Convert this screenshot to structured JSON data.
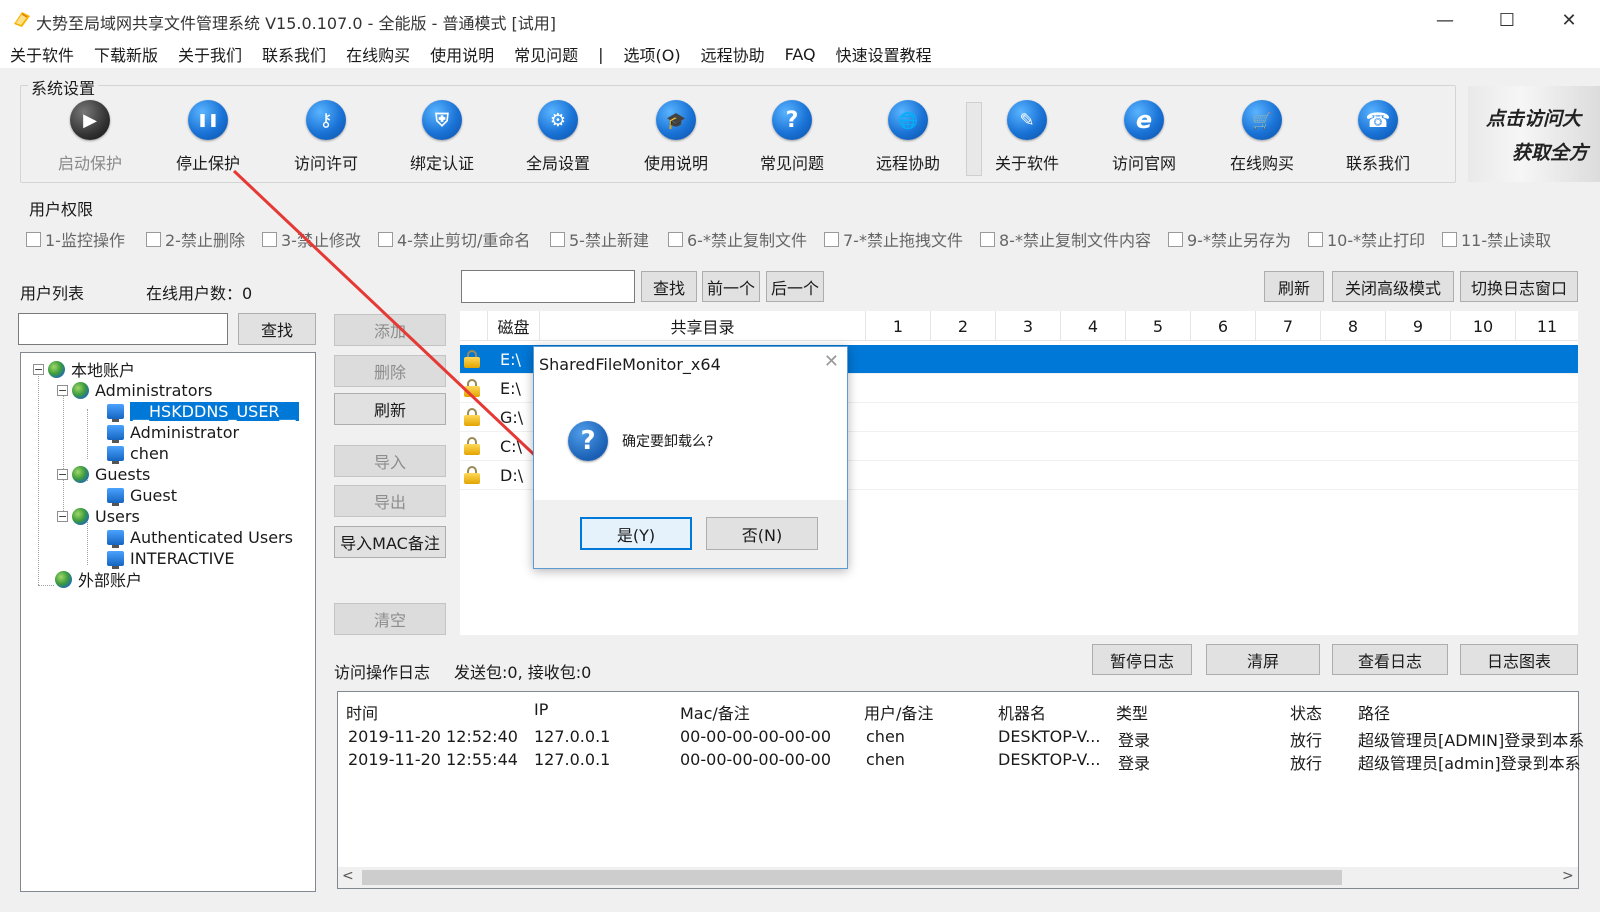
{
  "window": {
    "title": "大势至局域网共享文件管理系统 V15.0.107.0 - 全能版 - 普通模式 [试用]",
    "controls": {
      "minimize": "—",
      "maximize": "☐",
      "close": "✕"
    }
  },
  "menu": [
    "关于软件",
    "下载新版",
    "关于我们",
    "联系我们",
    "在线购买",
    "使用说明",
    "常见问题",
    "|",
    "选项(O)",
    "远程协助",
    "FAQ",
    "快速设置教程"
  ],
  "system_settings": {
    "title": "系统设置",
    "tools": [
      {
        "label": "启动保护",
        "icon": "play-icon",
        "glyph": "▶",
        "disabled": true
      },
      {
        "label": "停止保护",
        "icon": "pause-icon",
        "glyph": "❚❚",
        "disabled": false
      },
      {
        "label": "访问许可",
        "icon": "key-icon",
        "glyph": "⚷",
        "disabled": false
      },
      {
        "label": "绑定认证",
        "icon": "shield-icon",
        "glyph": "⛨",
        "disabled": false
      },
      {
        "label": "全局设置",
        "icon": "gear-icon",
        "glyph": "⚙",
        "disabled": false
      },
      {
        "label": "使用说明",
        "icon": "graduation-cap-icon",
        "glyph": "🎓",
        "disabled": false
      },
      {
        "label": "常见问题",
        "icon": "question-icon",
        "glyph": "?",
        "disabled": false
      },
      {
        "label": "远程协助",
        "icon": "globe-icon",
        "glyph": "🌐",
        "disabled": false
      },
      {
        "label": "关于软件",
        "icon": "edit-icon",
        "glyph": "✎",
        "disabled": false
      },
      {
        "label": "访问官网",
        "icon": "ie-icon",
        "glyph": "e",
        "disabled": false
      },
      {
        "label": "在线购买",
        "icon": "cart-icon",
        "glyph": "🛒",
        "disabled": false
      },
      {
        "label": "联系我们",
        "icon": "phone-icon",
        "glyph": "☎",
        "disabled": false
      }
    ],
    "banner": [
      "点击访问大",
      "获取全方"
    ]
  },
  "user_permissions": {
    "title": "用户权限",
    "items": [
      "1-监控操作",
      "2-禁止删除",
      "3-禁止修改",
      "4-禁止剪切/重命名",
      "5-禁止新建",
      "6-*禁止复制文件",
      "7-*禁止拖拽文件",
      "8-*禁止复制文件内容",
      "9-*禁止另存为",
      "10-*禁止打印",
      "11-禁止读取"
    ]
  },
  "user_list": {
    "label": "用户列表",
    "online_count": "在线用户数：0",
    "search_button": "查找",
    "search_value": "",
    "tree": {
      "local": "本地账户",
      "administrators": "Administrators",
      "hsk": "__HSKDDNS_USER__",
      "administrator": "Administrator",
      "chen": "chen",
      "guests": "Guests",
      "guest": "Guest",
      "users": "Users",
      "auth_users": "Authenticated Users",
      "interactive": "INTERACTIVE",
      "external": "外部账户"
    }
  },
  "side_buttons": {
    "add": "添加",
    "delete": "删除",
    "refresh": "刷新",
    "import": "导入",
    "export": "导出",
    "import_mac": "导入MAC备注",
    "clear": "清空"
  },
  "share_toolbar": {
    "search_value": "",
    "find": "查找",
    "prev": "前一个",
    "next": "后一个",
    "refresh": "刷新",
    "close_advanced": "关闭高级模式",
    "switch_log": "切换日志窗口"
  },
  "share_table": {
    "columns": [
      "磁盘",
      "共享目录",
      "1",
      "2",
      "3",
      "4",
      "5",
      "6",
      "7",
      "8",
      "9",
      "10",
      "11"
    ],
    "rows": [
      "E:\\",
      "E:\\",
      "G:\\",
      "C:\\",
      "D:\\"
    ]
  },
  "log": {
    "label": "访问操作日志",
    "stats": "发送包:0, 接收包:0",
    "pause": "暂停日志",
    "clear": "清屏",
    "view": "查看日志",
    "chart": "日志图表",
    "columns": [
      "时间",
      "IP",
      "Mac/备注",
      "用户/备注",
      "机器名",
      "类型",
      "状态",
      "路径"
    ],
    "rows": [
      [
        "2019-11-20 12:52:40",
        "127.0.0.1",
        "00-00-00-00-00-00",
        "chen",
        "DESKTOP-V...",
        "登录",
        "放行",
        "超级管理员[ADMIN]登录到本系"
      ],
      [
        "2019-11-20 12:55:44",
        "127.0.0.1",
        "00-00-00-00-00-00",
        "chen",
        "DESKTOP-V...",
        "登录",
        "放行",
        "超级管理员[admin]登录到本系"
      ]
    ],
    "scroll_left": "<",
    "scroll_right": ">"
  },
  "dialog": {
    "title": "SharedFileMonitor_x64",
    "message": "确定要卸载么?",
    "yes": "是(Y)",
    "no": "否(N)",
    "close": "✕"
  },
  "colors": {
    "selection": "#0078d7",
    "annotation_arrow": "#e53935"
  }
}
